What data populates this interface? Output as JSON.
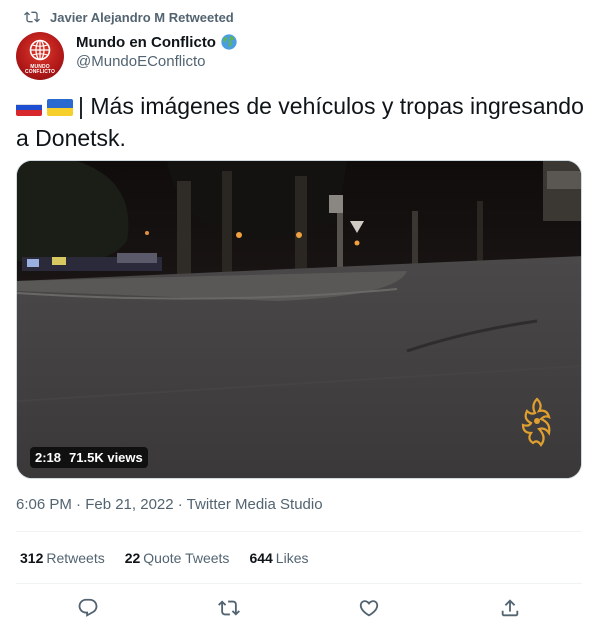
{
  "retweet": {
    "text": "Javier Alejandro M Retweeted",
    "icon": "retweet-icon"
  },
  "author": {
    "name": "Mundo en Conflicto",
    "handle": "@MundoEConflicto",
    "avatar_text": "MUNDO CONFLICTO",
    "badge_icon": "globe-emoji-icon"
  },
  "tweet": {
    "flags": [
      "russia-flag",
      "ukraine-flag"
    ],
    "text": "| Más imágenes de vehículos y tropas ingresando a Donetsk."
  },
  "media": {
    "duration": "2:18",
    "views": "71.5K views",
    "watermark": "al-jazeera-logo"
  },
  "timestamp": "6:06 PM · Feb 21, 2022 · Twitter Media Studio",
  "stats": {
    "retweets_count": "312",
    "retweets_label": "Retweets",
    "quotes_count": "22",
    "quotes_label": "Quote Tweets",
    "likes_count": "644",
    "likes_label": "Likes"
  },
  "actions": [
    "reply-icon",
    "retweet-icon",
    "like-icon",
    "share-icon"
  ],
  "colors": {
    "text": "#0f1419",
    "secondary": "#536471",
    "border": "#eff3f4"
  }
}
